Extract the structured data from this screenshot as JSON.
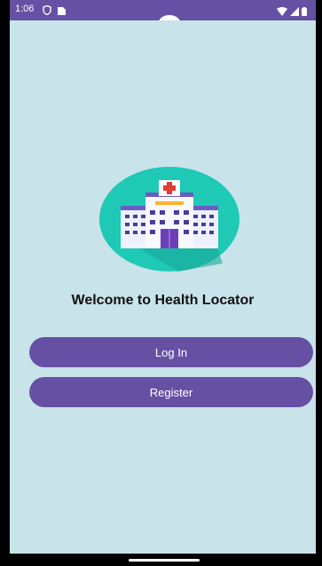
{
  "status_bar": {
    "time": "1:06",
    "icons_left": [
      "shield-icon",
      "sim-card-icon"
    ],
    "icons_right": [
      "wifi-icon",
      "signal-icon",
      "battery-icon"
    ]
  },
  "main": {
    "logo_icon": "hospital-icon",
    "welcome_text": "Welcome to Health Locator",
    "login_label": "Log In",
    "register_label": "Register"
  },
  "colors": {
    "primary": "#6650a4",
    "background": "#c9e3ea",
    "logo_circle": "#1ec9b6"
  }
}
